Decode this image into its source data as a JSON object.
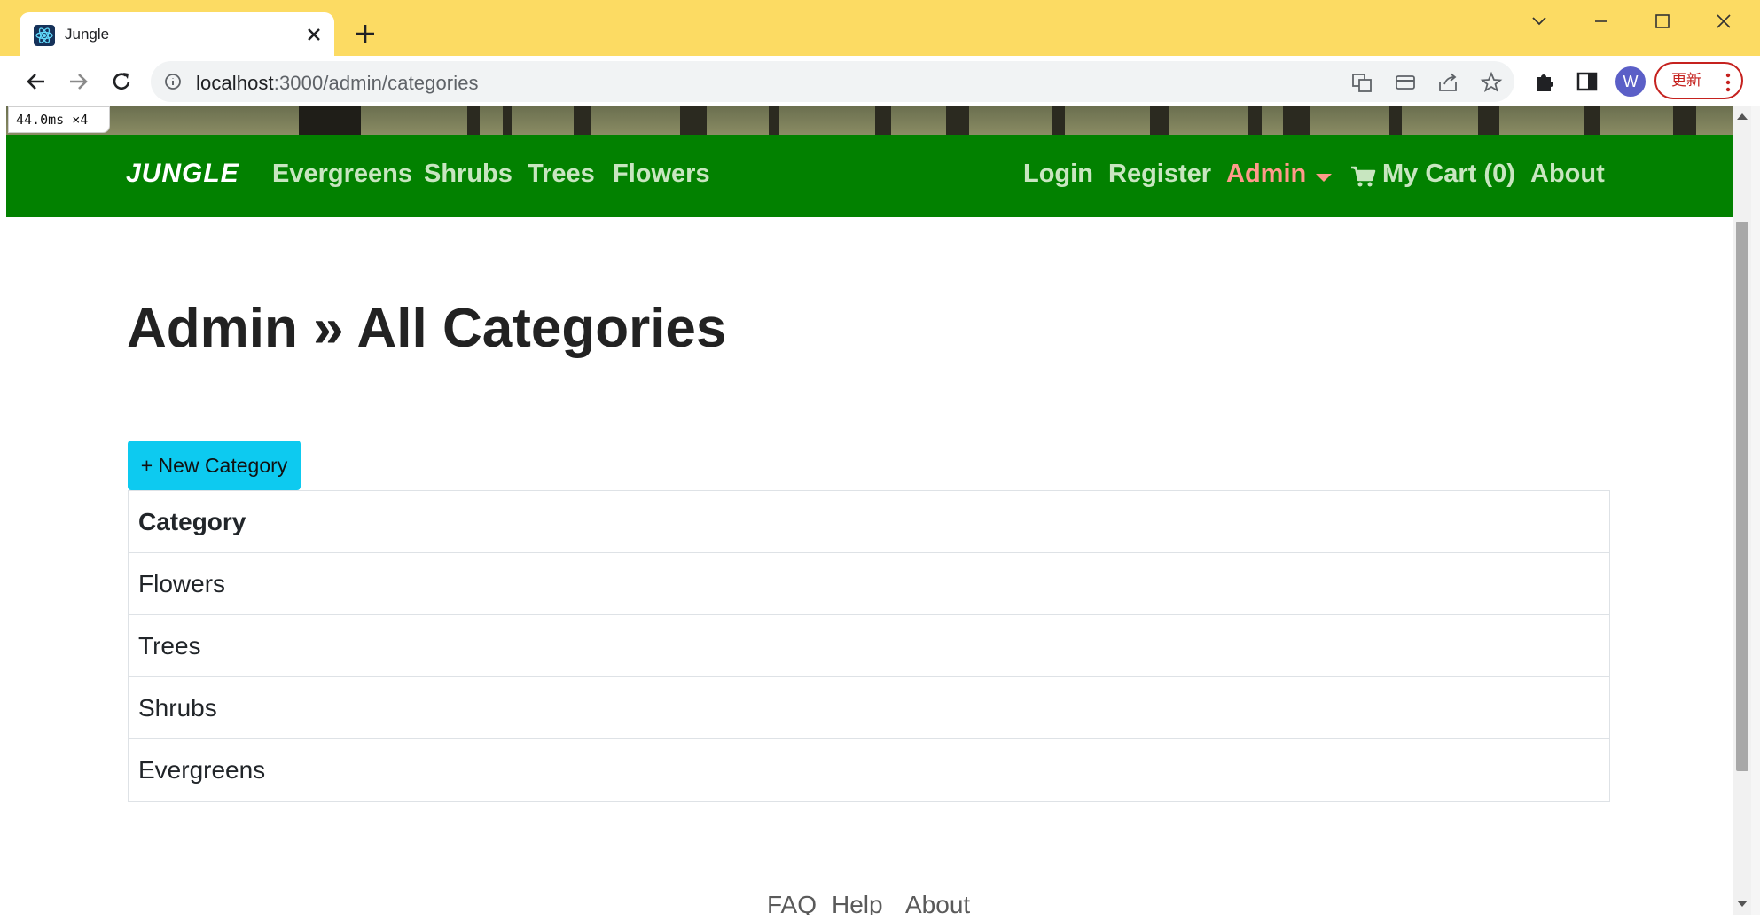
{
  "browser": {
    "tab_title": "Jungle",
    "url_host": "localhost",
    "url_path": ":3000/admin/categories",
    "profile_initial": "W",
    "update_label": "更新",
    "perf_badge": "44.0ms ×4"
  },
  "navbar": {
    "brand": "JUNGLE",
    "left_links": [
      "Evergreens",
      "Shrubs",
      "Trees",
      "Flowers"
    ],
    "login": "Login",
    "register": "Register",
    "admin": "Admin",
    "cart": "My Cart (0)",
    "about": "About"
  },
  "page": {
    "title": "Admin » All Categories",
    "new_button": "+ New Category",
    "table_header": "Category",
    "categories": [
      "Flowers",
      "Trees",
      "Shrubs",
      "Evergreens"
    ]
  },
  "footer": {
    "links": [
      "FAQ",
      "Help",
      "About"
    ]
  },
  "colors": {
    "titlebar": "#fcdb63",
    "navbar": "#028100",
    "nav_link": "#c8e6c0",
    "nav_active": "#ff9a8a",
    "button": "#0dcaf0"
  }
}
